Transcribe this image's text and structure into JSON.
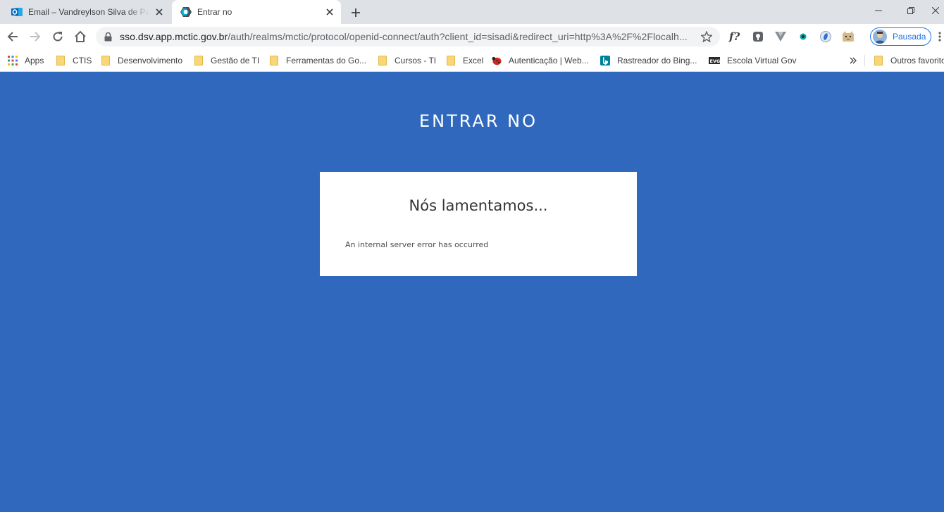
{
  "browser": {
    "tabs": [
      {
        "title": "Email – Vandreylson Silva de Paula",
        "favicon": "outlook-icon",
        "active": false
      },
      {
        "title": "Entrar no",
        "favicon": "keycloak-icon",
        "active": true
      }
    ],
    "address": {
      "host": "sso.dsv.app.mctic.gov.br",
      "path": "/auth/realms/mctic/protocol/openid-connect/auth?client_id=sisadi&redirect_uri=http%3A%2F%2Flocalh..."
    },
    "profile_label": "Pausada",
    "extensions": [
      "formula-icon",
      "pocket-icon",
      "vuejs-icon",
      "eye-icon",
      "color-picker-icon",
      "cat-icon"
    ]
  },
  "bookmarks": [
    {
      "label": "Apps",
      "icon": "apps-grid-icon"
    },
    {
      "label": "CTIS",
      "icon": "folder-icon"
    },
    {
      "label": "Desenvolvimento",
      "icon": "folder-icon"
    },
    {
      "label": "Gestão de TI",
      "icon": "folder-icon"
    },
    {
      "label": "Ferramentas do Go...",
      "icon": "folder-icon"
    },
    {
      "label": "Cursos - TI",
      "icon": "folder-icon"
    },
    {
      "label": "Excel",
      "icon": "folder-icon"
    },
    {
      "label": "Autenticação | Web...",
      "icon": "ladybug-icon"
    },
    {
      "label": "Rastreador do Bing...",
      "icon": "bing-icon"
    },
    {
      "label": "Escola Virtual Gov",
      "icon": "evg-icon"
    },
    {
      "label": "Outros favoritos",
      "icon": "folder-icon"
    }
  ],
  "page": {
    "header": "ENTRAR NO",
    "card_title": "Nós lamentamos...",
    "error_message": "An internal server error has occurred",
    "background_color": "#2f68bd"
  }
}
